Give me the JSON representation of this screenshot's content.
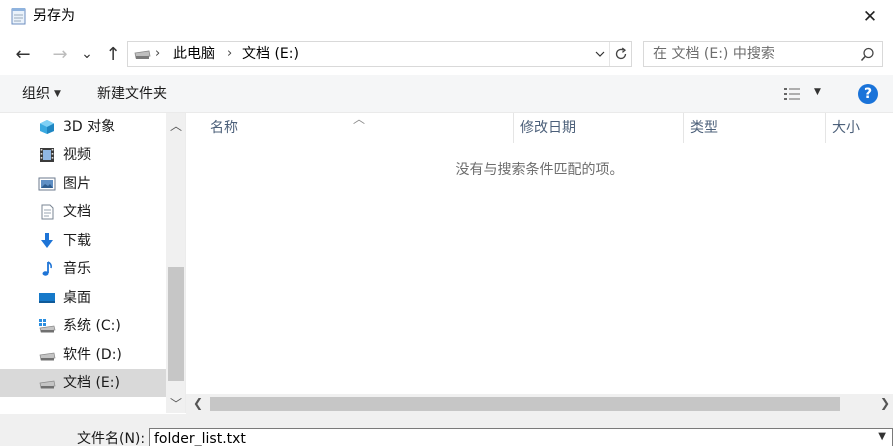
{
  "window": {
    "title": "另存为",
    "close_glyph": "✕"
  },
  "nav": {
    "back_glyph": "←",
    "forward_glyph": "→",
    "recent_glyph": "⌄",
    "up_glyph": "↑",
    "breadcrumb": [
      "此电脑",
      "文档 (E:)"
    ],
    "separator": "›",
    "search_placeholder": "在 文档 (E:) 中搜索"
  },
  "toolbar": {
    "organize": "组织",
    "new_folder": "新建文件夹",
    "help": "?"
  },
  "sidebar": {
    "items": [
      {
        "label": "3D 对象",
        "icon": "3d-objects-icon"
      },
      {
        "label": "视频",
        "icon": "video-icon"
      },
      {
        "label": "图片",
        "icon": "pictures-icon"
      },
      {
        "label": "文档",
        "icon": "documents-icon"
      },
      {
        "label": "下载",
        "icon": "download-icon"
      },
      {
        "label": "音乐",
        "icon": "music-icon"
      },
      {
        "label": "桌面",
        "icon": "desktop-icon"
      },
      {
        "label": "系统 (C:)",
        "icon": "system-drive-icon"
      },
      {
        "label": "软件 (D:)",
        "icon": "drive-icon"
      },
      {
        "label": "文档 (E:)",
        "icon": "drive-icon",
        "selected": true
      }
    ]
  },
  "filelist": {
    "columns": [
      "名称",
      "修改日期",
      "类型",
      "大小"
    ],
    "empty_message": "没有与搜索条件匹配的项。"
  },
  "save": {
    "filename_label": "文件名(N):",
    "filename_value": "folder_list.txt"
  },
  "colors": {
    "accent": "#1a73d9",
    "header_text": "#4c607a",
    "selected_bg": "#d9d9d9"
  }
}
